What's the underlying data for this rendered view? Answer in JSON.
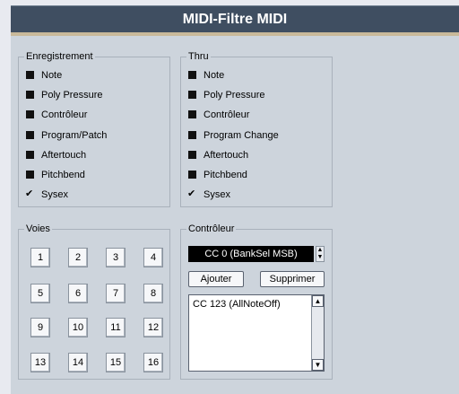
{
  "title": "MIDI-Filtre MIDI",
  "recording": {
    "title": "Enregistrement",
    "items": [
      {
        "label": "Note",
        "checked": false
      },
      {
        "label": "Poly Pressure",
        "checked": false
      },
      {
        "label": "Contrôleur",
        "checked": false
      },
      {
        "label": "Program/Patch",
        "checked": false
      },
      {
        "label": "Aftertouch",
        "checked": false
      },
      {
        "label": "Pitchbend",
        "checked": false
      },
      {
        "label": "Sysex",
        "checked": true
      }
    ]
  },
  "thru": {
    "title": "Thru",
    "items": [
      {
        "label": "Note",
        "checked": false
      },
      {
        "label": "Poly Pressure",
        "checked": false
      },
      {
        "label": "Contrôleur",
        "checked": false
      },
      {
        "label": "Program Change",
        "checked": false
      },
      {
        "label": "Aftertouch",
        "checked": false
      },
      {
        "label": "Pitchbend",
        "checked": false
      },
      {
        "label": "Sysex",
        "checked": true
      }
    ]
  },
  "channels": {
    "title": "Voies",
    "buttons": [
      "1",
      "2",
      "3",
      "4",
      "5",
      "6",
      "7",
      "8",
      "9",
      "10",
      "11",
      "12",
      "13",
      "14",
      "15",
      "16"
    ]
  },
  "controller": {
    "title": "Contrôleur",
    "selected": "CC 0 (BankSel MSB)",
    "add_label": "Ajouter",
    "remove_label": "Supprimer",
    "list": [
      "CC 123 (AllNoteOff)"
    ]
  }
}
